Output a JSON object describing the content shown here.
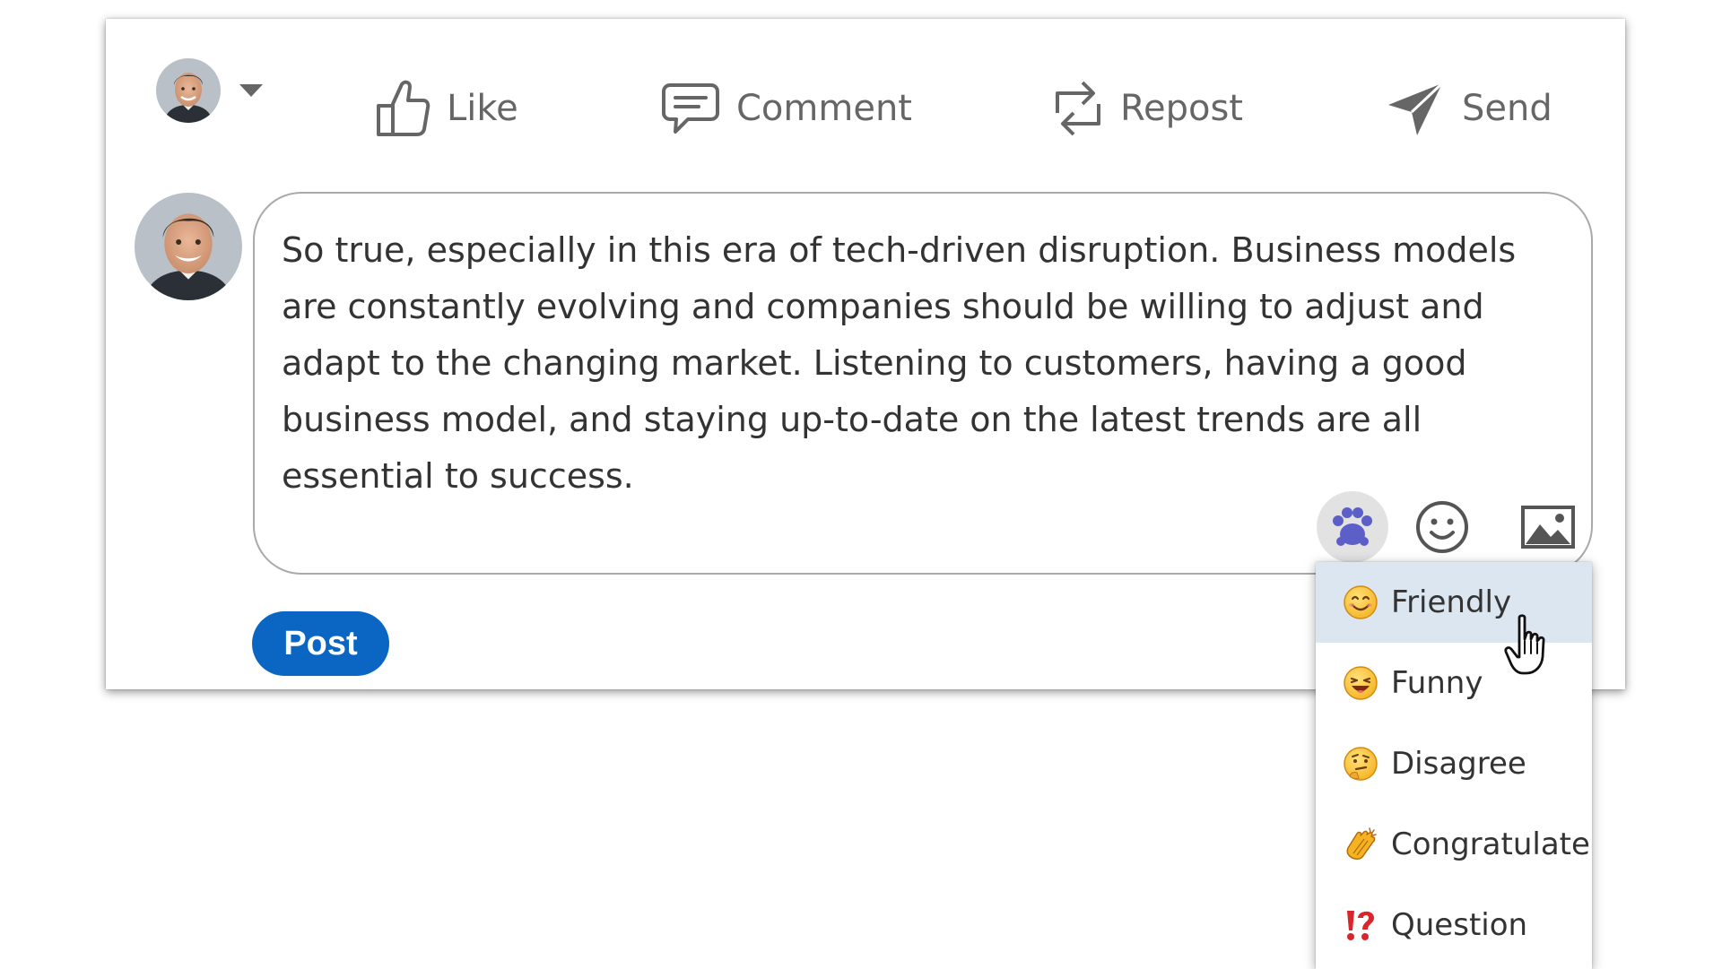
{
  "actions": {
    "like_label": "Like",
    "comment_label": "Comment",
    "repost_label": "Repost",
    "send_label": "Send"
  },
  "composer": {
    "text": "So true, especially in this era of tech-driven disruption. Business models are constantly evolving and companies should be willing to adjust and adapt to the changing market. Listening to customers, having a good business model, and staying up-to-date on the latest trends are all essential to success."
  },
  "post_button": {
    "label": "Post"
  },
  "tone_menu": {
    "items": [
      {
        "label": "Friendly",
        "icon": "smiling-face-icon",
        "selected": true
      },
      {
        "label": "Funny",
        "icon": "laughing-face-icon"
      },
      {
        "label": "Disagree",
        "icon": "thinking-face-icon"
      },
      {
        "label": "Congratulate",
        "icon": "clapping-hands-icon"
      },
      {
        "label": "Question",
        "icon": "exclamation-question-icon"
      }
    ]
  },
  "colors": {
    "accent": "#0a66c2",
    "icon_gray": "#666666",
    "tone_icon": "#5b5fc7",
    "menu_highlight": "#dce6f1"
  }
}
